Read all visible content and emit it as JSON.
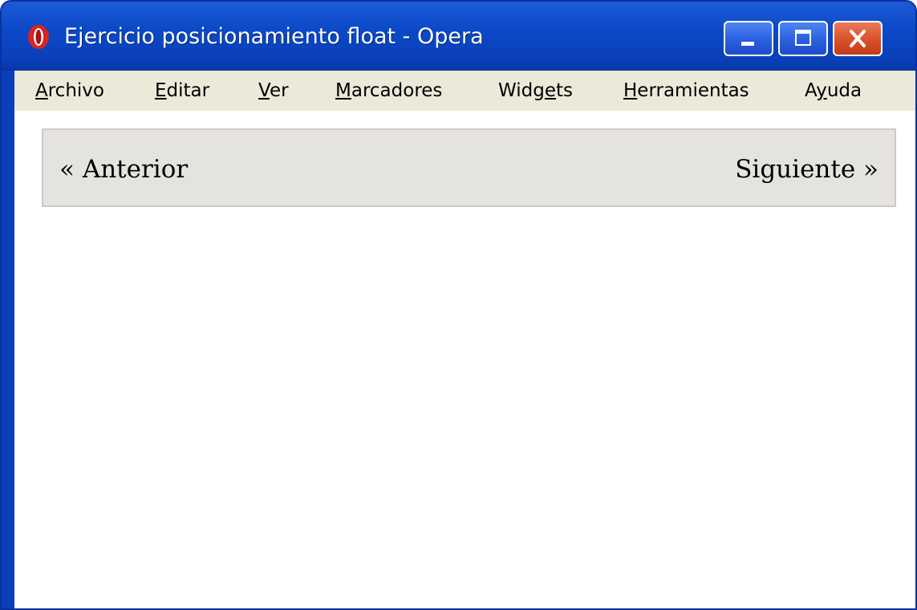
{
  "window": {
    "title": "Ejercicio posicionamiento float - Opera",
    "app_icon": "opera-logo-icon",
    "controls": [
      "minimize-icon",
      "maximize-icon",
      "close-icon"
    ]
  },
  "menubar": {
    "items": [
      {
        "underline": "A",
        "rest": "rchivo"
      },
      {
        "underline": "E",
        "rest": "ditar"
      },
      {
        "underline": "V",
        "rest": "er"
      },
      {
        "underline": "M",
        "rest": "arcadores"
      },
      {
        "pre": "Widg",
        "underline": "e",
        "rest": "ts"
      },
      {
        "underline": "H",
        "rest": "erramientas"
      },
      {
        "pre": "A",
        "underline": "y",
        "rest": "uda"
      }
    ]
  },
  "nav": {
    "previous": "« Anterior",
    "next": "Siguiente »"
  },
  "colors": {
    "titlebar": "#0a3fb8",
    "menubar": "#ece9d8",
    "nav_background": "#e5e3e0",
    "nav_border": "#cdcac6",
    "close_button": "#d9502a"
  }
}
